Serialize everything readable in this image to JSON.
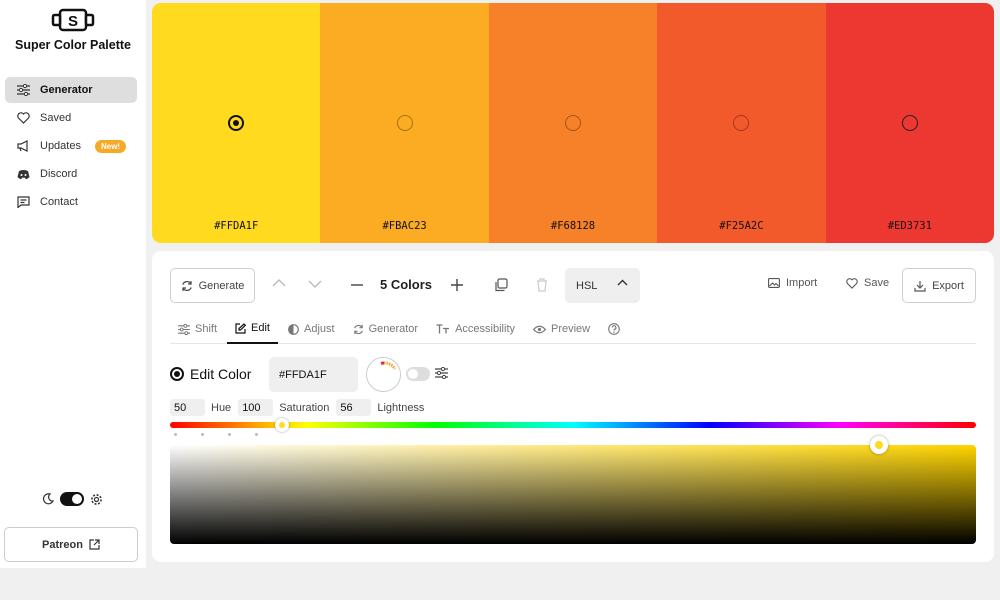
{
  "brand": {
    "name": "Super Color Palette",
    "logo_letter": "S"
  },
  "sidebar": {
    "items": [
      {
        "label": "Generator",
        "icon": "sliders-icon",
        "active": true
      },
      {
        "label": "Saved",
        "icon": "heart-icon",
        "active": false
      },
      {
        "label": "Updates",
        "icon": "megaphone-icon",
        "active": false,
        "badge": "New!"
      },
      {
        "label": "Discord",
        "icon": "discord-icon",
        "active": false
      },
      {
        "label": "Contact",
        "icon": "message-icon",
        "active": false
      }
    ],
    "patreon_label": "Patreon"
  },
  "palette": {
    "swatches": [
      {
        "hex": "#FFDA1F",
        "color": "#FFDA1F",
        "selected": true
      },
      {
        "hex": "#FBAC23",
        "color": "#FBAC23",
        "selected": false
      },
      {
        "hex": "#F68128",
        "color": "#F68128",
        "selected": false
      },
      {
        "hex": "#F25A2C",
        "color": "#F25A2C",
        "selected": false
      },
      {
        "hex": "#ED3731",
        "color": "#ED3731",
        "selected": false
      }
    ]
  },
  "toolbar": {
    "generate_label": "Generate",
    "count_label": "5 Colors",
    "mode_label": "HSL",
    "import_label": "Import",
    "save_label": "Save",
    "export_label": "Export"
  },
  "tabs": [
    {
      "label": "Shift",
      "icon": "sliders-icon",
      "active": false
    },
    {
      "label": "Edit",
      "icon": "pencil-icon",
      "active": true
    },
    {
      "label": "Adjust",
      "icon": "contrast-icon",
      "active": false
    },
    {
      "label": "Generator",
      "icon": "refresh-icon",
      "active": false
    },
    {
      "label": "Accessibility",
      "icon": "text-size-icon",
      "active": false
    },
    {
      "label": "Preview",
      "icon": "eye-icon",
      "active": false
    }
  ],
  "editor": {
    "title": "Edit Color",
    "hex_value": "#FFDA1F",
    "hue": {
      "value": "50",
      "label": "Hue"
    },
    "saturation": {
      "value": "100",
      "label": "Saturation"
    },
    "lightness": {
      "value": "56",
      "label": "Lightness"
    },
    "hue_degrees": 50,
    "saturation_percent": 100,
    "lightness_percent": 56
  }
}
